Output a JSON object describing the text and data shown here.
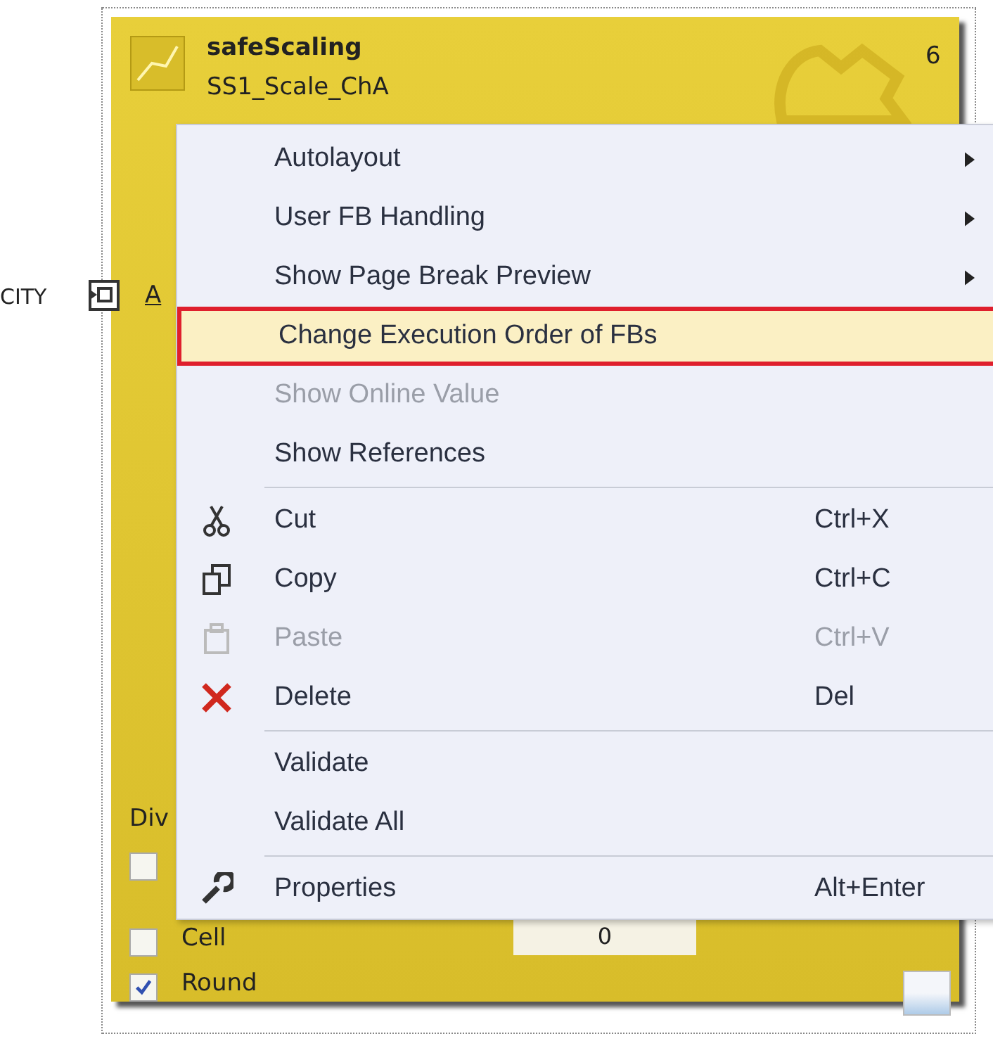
{
  "block": {
    "title": "safeScaling",
    "instance": "SS1_Scale_ChA",
    "number": "6",
    "left_label": "CITY",
    "pin_label": "A",
    "section_label": "Div",
    "options": [
      {
        "checked": false
      },
      {
        "label": "Cell",
        "checked": false
      },
      {
        "label": "Round",
        "checked": true
      }
    ],
    "value_field": "0"
  },
  "context_menu": {
    "groups": [
      [
        {
          "label": "Autolayout",
          "submenu": true,
          "disabled": false,
          "selected": false
        },
        {
          "label": "User FB Handling",
          "submenu": true,
          "disabled": false,
          "selected": false
        },
        {
          "label": "Show Page Break Preview",
          "submenu": true,
          "disabled": false,
          "selected": false
        },
        {
          "label": "Change Execution Order of FBs",
          "submenu": false,
          "disabled": false,
          "selected": true
        },
        {
          "label": "Show Online Value",
          "submenu": false,
          "disabled": true,
          "selected": false
        },
        {
          "label": "Show References",
          "submenu": false,
          "disabled": false,
          "selected": false
        }
      ],
      [
        {
          "label": "Cut",
          "shortcut": "Ctrl+X",
          "submenu": false,
          "disabled": false,
          "selected": false
        },
        {
          "label": "Copy",
          "shortcut": "Ctrl+C",
          "submenu": false,
          "disabled": false,
          "selected": false
        },
        {
          "label": "Paste",
          "shortcut": "Ctrl+V",
          "submenu": false,
          "disabled": true,
          "selected": false
        },
        {
          "label": "Delete",
          "shortcut": "Del",
          "submenu": false,
          "disabled": false,
          "selected": false
        }
      ],
      [
        {
          "label": "Validate",
          "submenu": false,
          "disabled": false,
          "selected": false
        },
        {
          "label": "Validate All",
          "submenu": false,
          "disabled": false,
          "selected": false
        }
      ],
      [
        {
          "label": "Properties",
          "shortcut": "Alt+Enter",
          "submenu": false,
          "disabled": false,
          "selected": false
        }
      ]
    ]
  }
}
